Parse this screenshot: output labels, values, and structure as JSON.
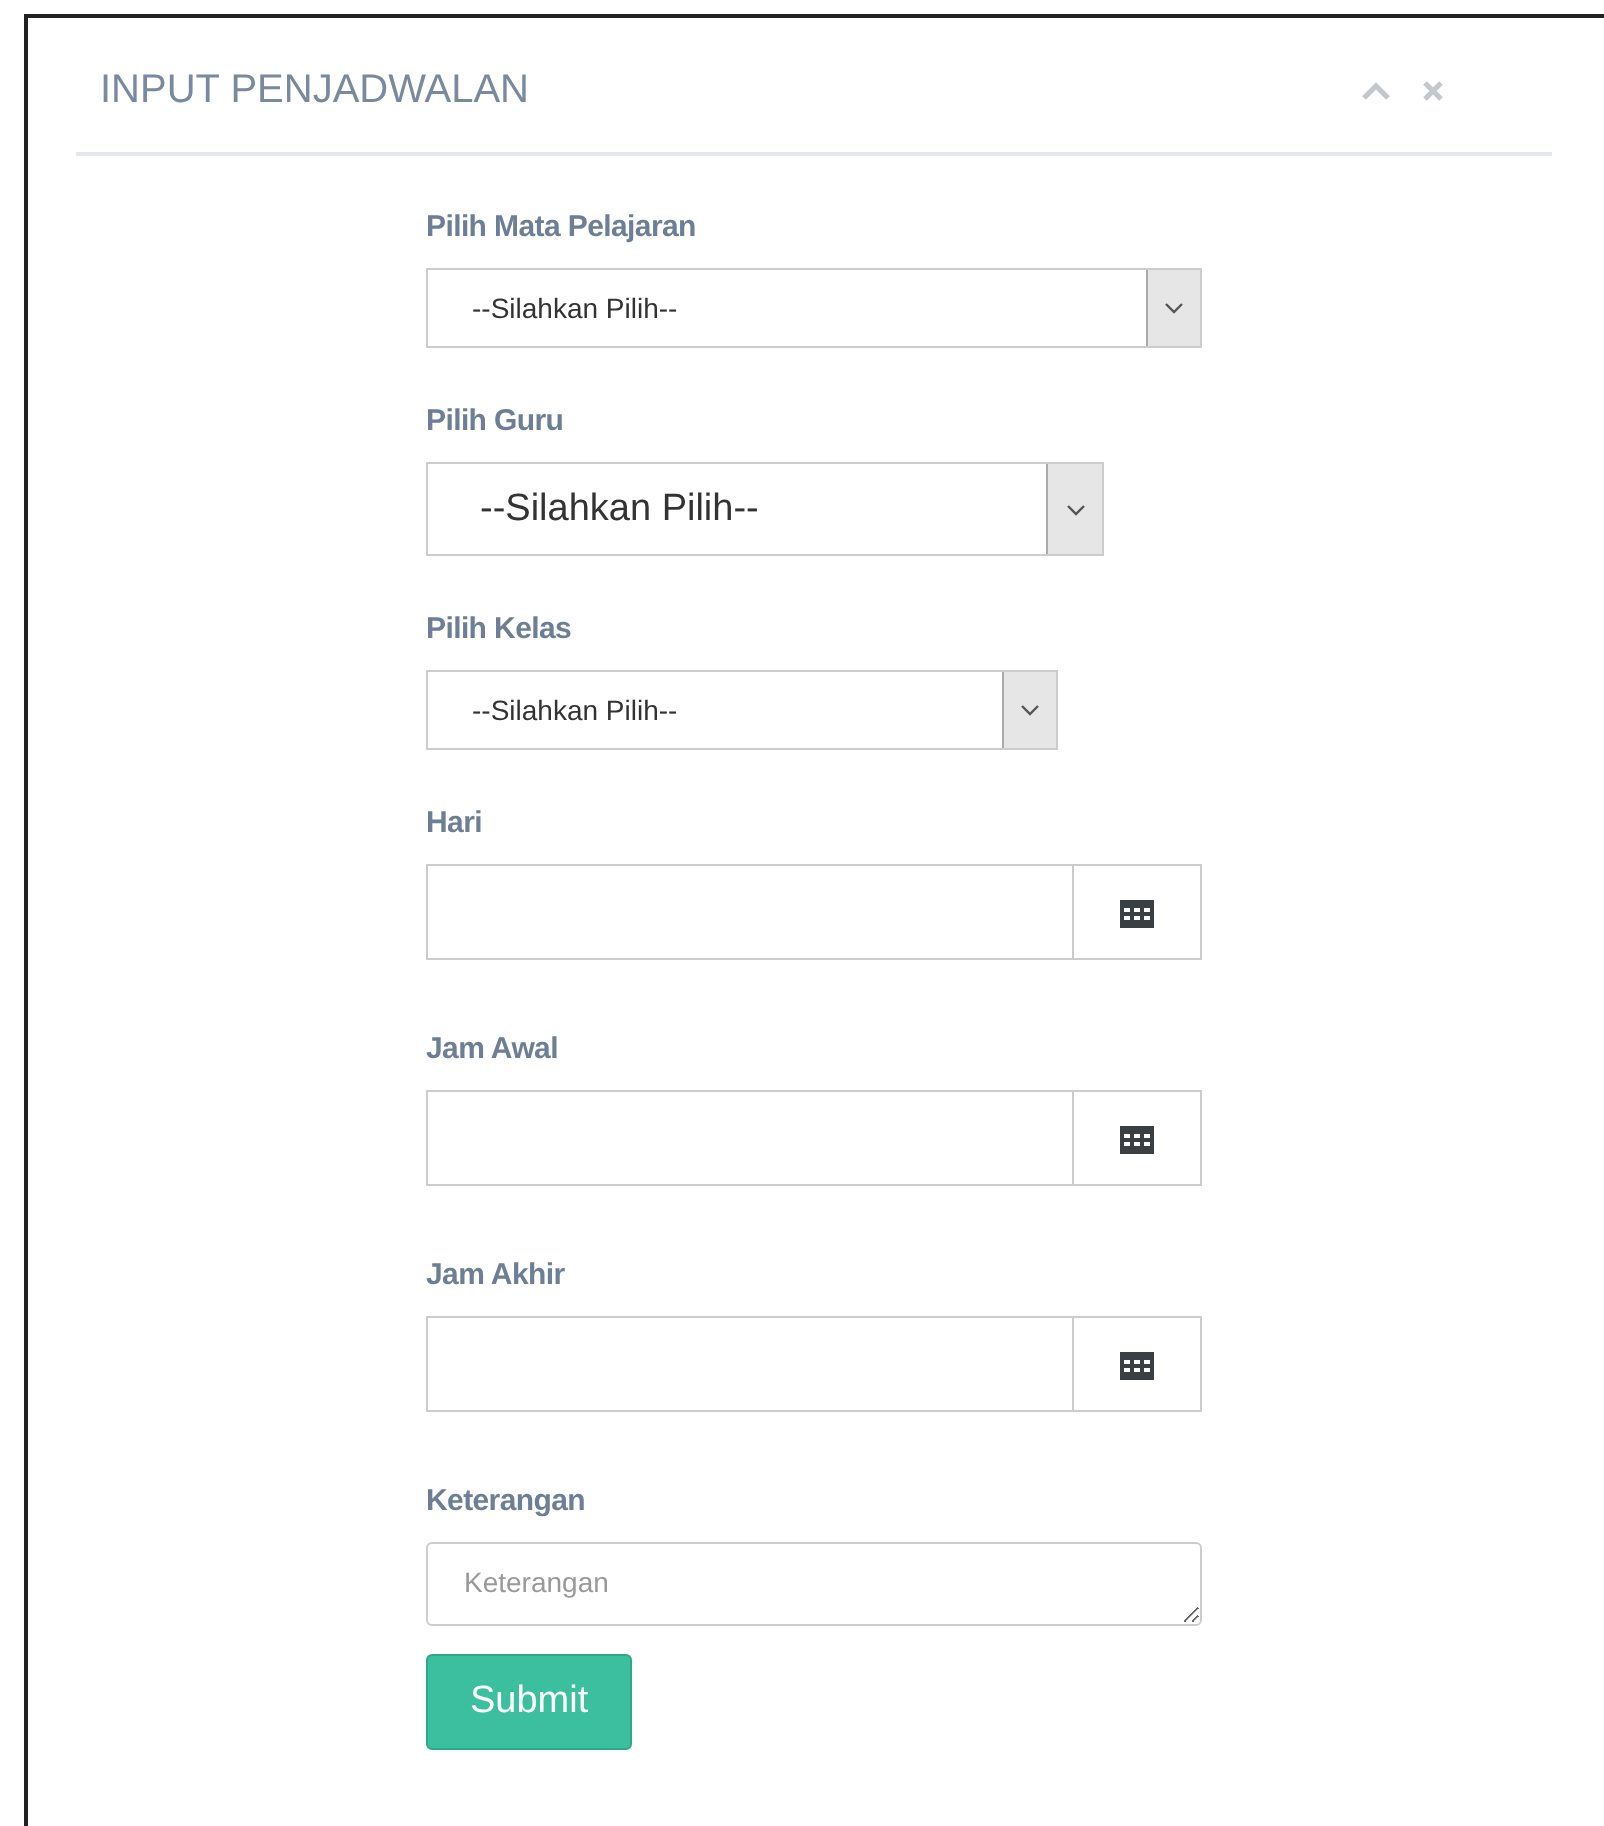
{
  "panel": {
    "title": "INPUT PENJADWALAN"
  },
  "fields": [
    {
      "kind": "select",
      "label": "Pilih Mata Pelajaran",
      "value": "--Silahkan Pilih--"
    },
    {
      "kind": "select",
      "label": "Pilih Guru",
      "value": "--Silahkan Pilih--"
    },
    {
      "kind": "select",
      "label": "Pilih Kelas",
      "value": "--Silahkan Pilih--"
    },
    {
      "kind": "date",
      "label": "Hari"
    },
    {
      "kind": "date",
      "label": "Jam Awal"
    },
    {
      "kind": "date",
      "label": "Jam Akhir"
    },
    {
      "kind": "textarea",
      "label": "Keterangan",
      "placeholder": "Keterangan"
    }
  ],
  "submit": "Submit"
}
